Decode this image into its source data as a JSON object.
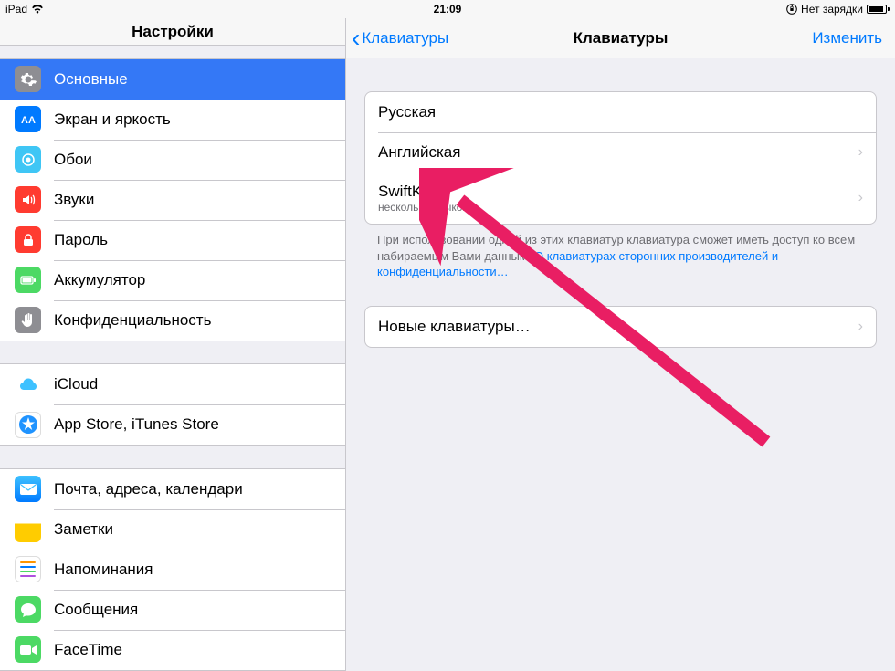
{
  "statusbar": {
    "device": "iPad",
    "time": "21:09",
    "charge_text": "Нет зарядки"
  },
  "sidebar": {
    "title": "Настройки",
    "group1": [
      {
        "label": "Основные",
        "icon": "general"
      },
      {
        "label": "Экран и яркость",
        "icon": "display"
      },
      {
        "label": "Обои",
        "icon": "wallpaper"
      },
      {
        "label": "Звуки",
        "icon": "sounds"
      },
      {
        "label": "Пароль",
        "icon": "passcode"
      },
      {
        "label": "Аккумулятор",
        "icon": "battery"
      },
      {
        "label": "Конфиденциальность",
        "icon": "privacy"
      }
    ],
    "group2": [
      {
        "label": "iCloud",
        "icon": "icloud"
      },
      {
        "label": "App Store, iTunes Store",
        "icon": "appstore"
      }
    ],
    "group3": [
      {
        "label": "Почта, адреса, календари",
        "icon": "mail"
      },
      {
        "label": "Заметки",
        "icon": "notes"
      },
      {
        "label": "Напоминания",
        "icon": "reminders"
      },
      {
        "label": "Сообщения",
        "icon": "messages"
      },
      {
        "label": "FaceTime",
        "icon": "facetime"
      }
    ]
  },
  "detail": {
    "back_label": "Клавиатуры",
    "title": "Клавиатуры",
    "edit_label": "Изменить",
    "keyboards": [
      {
        "label": "Русская"
      },
      {
        "label": "Английская",
        "chevron": true
      },
      {
        "label": "SwiftKey",
        "sub": "несколько языков",
        "chevron": true
      }
    ],
    "footnote_pre": "При использовании одной из этих клавиатур клавиатура сможет иметь доступ ко всем набираемым Вами данным. ",
    "footnote_link": "О клавиатурах сторонних производителей и конфиденциальности…",
    "add_label": "Новые клавиатуры…"
  }
}
